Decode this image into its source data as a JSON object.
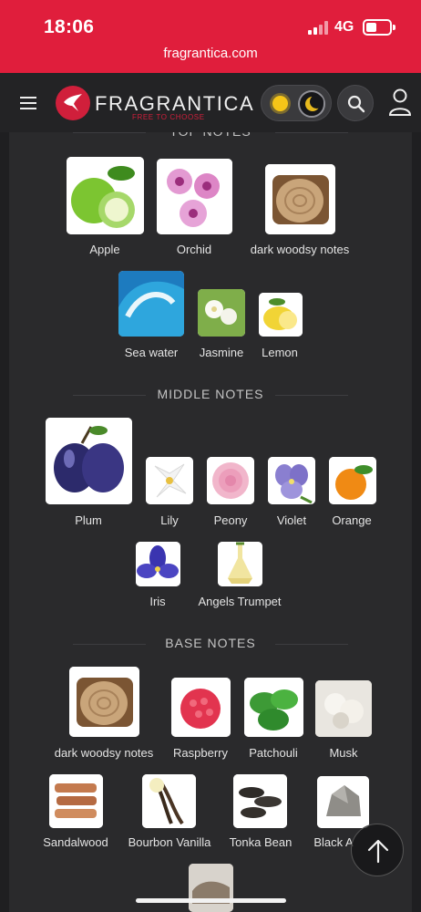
{
  "status_bar": {
    "time": "18:06",
    "network": "4G",
    "url": "fragrantica.com"
  },
  "header": {
    "brand": "FRAGRANTICA",
    "tagline": "FREE TO CHOOSE",
    "menu_icon": "hamburger-icon",
    "theme_icons": [
      "sun-icon",
      "moon-icon"
    ],
    "search_icon": "search-icon",
    "user_icon": "user-icon"
  },
  "sections": {
    "top": "TOP NOTES",
    "middle": "MIDDLE NOTES",
    "base": "BASE NOTES"
  },
  "top_notes": [
    "Apple",
    "Orchid",
    "dark woodsy notes",
    "Sea water",
    "Jasmine",
    "Lemon"
  ],
  "middle_notes": [
    "Plum",
    "Lily",
    "Peony",
    "Violet",
    "Orange",
    "Iris",
    "Angels Trumpet"
  ],
  "base_notes": [
    "dark woodsy notes",
    "Raspberry",
    "Patchouli",
    "Musk",
    "Sandalwood",
    "Bourbon Vanilla",
    "Tonka Bean",
    "Black A"
  ],
  "scroll_top_icon": "arrow-up-icon",
  "colors": {
    "brand_red": "#e01e3c",
    "background": "#1f1f21"
  }
}
